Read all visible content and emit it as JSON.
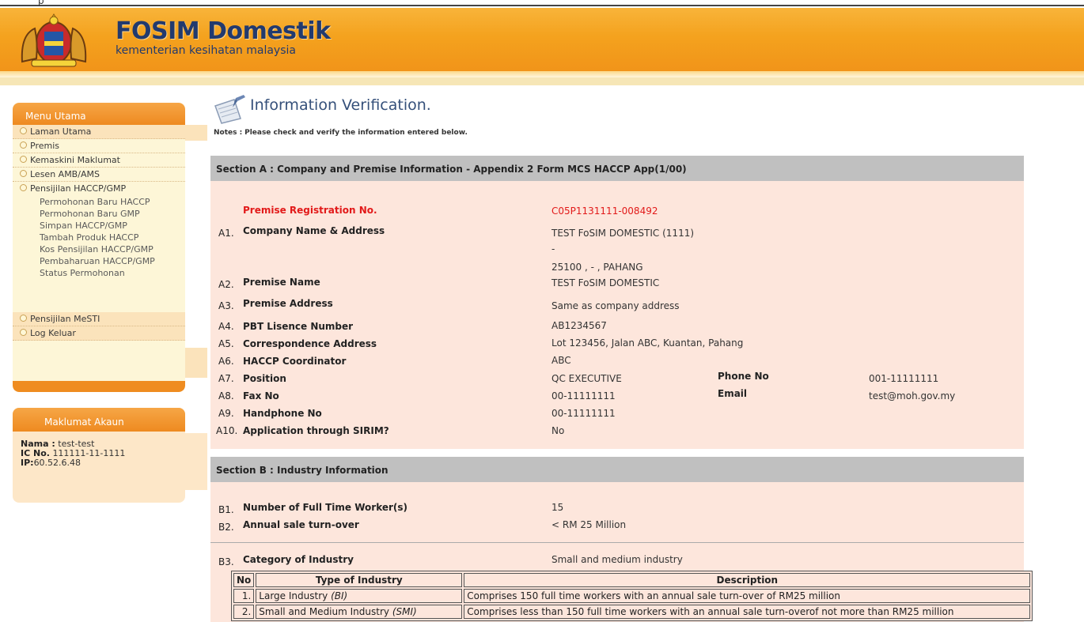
{
  "header": {
    "top_tiny_text": "p",
    "title": "FOSIM Domestik",
    "subtitle": "kementerian kesihatan malaysia"
  },
  "menu": {
    "heading": "Menu Utama",
    "items": [
      {
        "label": "Laman Utama"
      },
      {
        "label": "Premis"
      },
      {
        "label": "Kemaskini Maklumat"
      },
      {
        "label": "Lesen AMB/AMS"
      },
      {
        "label": "Pensijilan HACCP/GMP"
      }
    ],
    "sub_items": [
      "Permohonan Baru HACCP",
      "Permohonan Baru GMP",
      "Simpan HACCP/GMP",
      "Tambah Produk HACCP",
      "Kos Pensijilan HACCP/GMP",
      "Pembaharuan HACCP/GMP",
      "Status Permohonan"
    ],
    "bottom_items": [
      {
        "label": "Pensijilan MeSTI"
      },
      {
        "label": "Log Keluar"
      }
    ]
  },
  "account": {
    "heading": "Maklumat Akaun",
    "name_label": "Nama :",
    "name_value": "test-test",
    "ic_label": "IC No.",
    "ic_value": "111111-11-1111",
    "ip_label": "IP:",
    "ip_value": "60.52.6.48"
  },
  "page": {
    "title": "Information Verification.",
    "notes_label": "Notes :",
    "notes_text": "Please check and verify the information entered below."
  },
  "section_a": {
    "heading": "Section A : Company and Premise Information - Appendix 2 Form MCS HACCP App(1/00)",
    "premise_reg_label": "Premise Registration No.",
    "premise_reg_value": "C05P1131111-008492",
    "rows": [
      {
        "num": "A1.",
        "label": "Company Name & Address",
        "value": "TEST FoSIM DOMESTIC (1111)"
      },
      {
        "num": "A2.",
        "label": "Premise Name",
        "value": "TEST FoSIM DOMESTIC"
      },
      {
        "num": "A3.",
        "label": "Premise Address",
        "value": "Same as company address"
      },
      {
        "num": "A4.",
        "label": "PBT Lisence Number",
        "value": "AB1234567"
      },
      {
        "num": "A5.",
        "label": "Correspondence Address",
        "value": "Lot 123456, Jalan ABC, Kuantan, Pahang"
      },
      {
        "num": "A6.",
        "label": "HACCP Coordinator",
        "value": "ABC"
      },
      {
        "num": "A7.",
        "label": "Position",
        "value": "QC EXECUTIVE"
      },
      {
        "num": "A8.",
        "label": "Fax No",
        "value": "00-11111111"
      },
      {
        "num": "A9.",
        "label": "Handphone No",
        "value": "00-11111111"
      },
      {
        "num": "A10.",
        "label": "Application through SIRIM?",
        "value": "No"
      }
    ],
    "address_line2": "-",
    "address_line3": "25100 , - , PAHANG",
    "phone_label": "Phone No",
    "phone_value": "001-11111111",
    "email_label": "Email",
    "email_value": "test@moh.gov.my"
  },
  "section_b": {
    "heading": "Section B : Industry Information",
    "rows": [
      {
        "num": "B1.",
        "label": "Number of Full Time Worker(s)",
        "value": "15"
      },
      {
        "num": "B2.",
        "label": "Annual sale turn-over",
        "value": "< RM 25 Million"
      },
      {
        "num": "B3.",
        "label": "Category of Industry",
        "value": "Small and medium industry"
      }
    ],
    "table": {
      "headers": [
        "No",
        "Type of Industry",
        "Description"
      ],
      "rows": [
        {
          "no": "1.",
          "type": "Large Industry",
          "abbr": "(BI)",
          "desc": "Comprises 150 full time workers with an annual sale turn-over of RM25 million"
        },
        {
          "no": "2.",
          "type": "Small and Medium Industry",
          "abbr": "(SMI)",
          "desc": "Comprises less than 150 full time workers with an annual sale turn-overof not more than RM25 million"
        }
      ]
    }
  }
}
